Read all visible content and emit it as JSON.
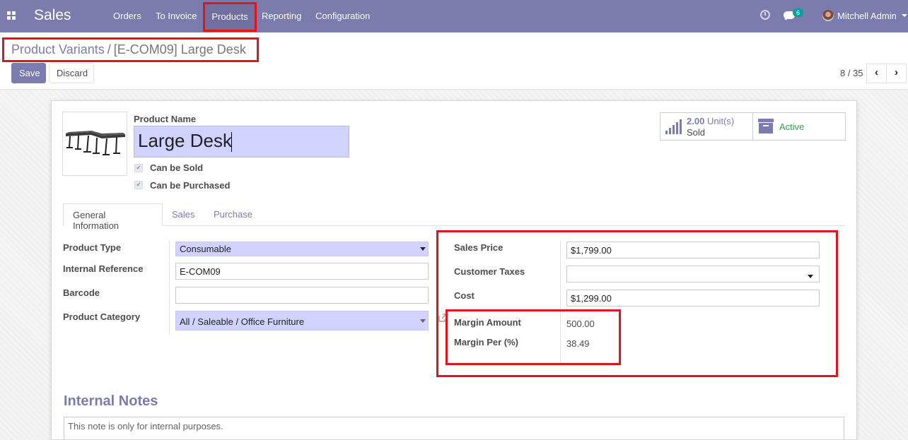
{
  "navbar": {
    "app_name": "Sales",
    "menu": [
      "Orders",
      "To Invoice",
      "Products",
      "Reporting",
      "Configuration"
    ],
    "active_menu": "Products",
    "chat_badge": "6",
    "user_name": "Mitchell Admin"
  },
  "breadcrumb": {
    "parent": "Product Variants",
    "separator": "/",
    "current": "[E-COM09] Large Desk"
  },
  "actions": {
    "save_label": "Save",
    "discard_label": "Discard"
  },
  "pager": {
    "value": "8 / 35",
    "prev": "‹",
    "next": "›"
  },
  "product": {
    "name_label": "Product Name",
    "name": "Large Desk",
    "can_be_sold_label": "Can be Sold",
    "can_be_purchased_label": "Can be Purchased",
    "can_be_sold": true,
    "can_be_purchased": true
  },
  "smart_buttons": {
    "sold_value": "2.00",
    "sold_unit": "Unit(s)",
    "sold_label": "Sold",
    "active_label": "Active"
  },
  "tabs": [
    "General Information",
    "Sales",
    "Purchase"
  ],
  "active_tab": "General Information",
  "general": {
    "product_type_label": "Product Type",
    "product_type": "Consumable",
    "internal_reference_label": "Internal Reference",
    "internal_reference": "E-COM09",
    "barcode_label": "Barcode",
    "barcode": "",
    "product_category_label": "Product Category",
    "product_category": "All / Saleable / Office Furniture"
  },
  "pricing": {
    "sales_price_label": "Sales Price",
    "sales_price": "$1,799.00",
    "customer_taxes_label": "Customer Taxes",
    "customer_taxes": "",
    "cost_label": "Cost",
    "cost": "$1,299.00",
    "margin_amount_label": "Margin Amount",
    "margin_amount": "500.00",
    "margin_per_label": "Margin Per (%)",
    "margin_per": "38.49"
  },
  "notes": {
    "title": "Internal Notes",
    "placeholder": "This note is only for internal purposes."
  },
  "colors": {
    "brand": "#7c7bad",
    "highlight": "#e0151b",
    "active_green": "#28a745",
    "field_required": "#d2d2ff"
  }
}
